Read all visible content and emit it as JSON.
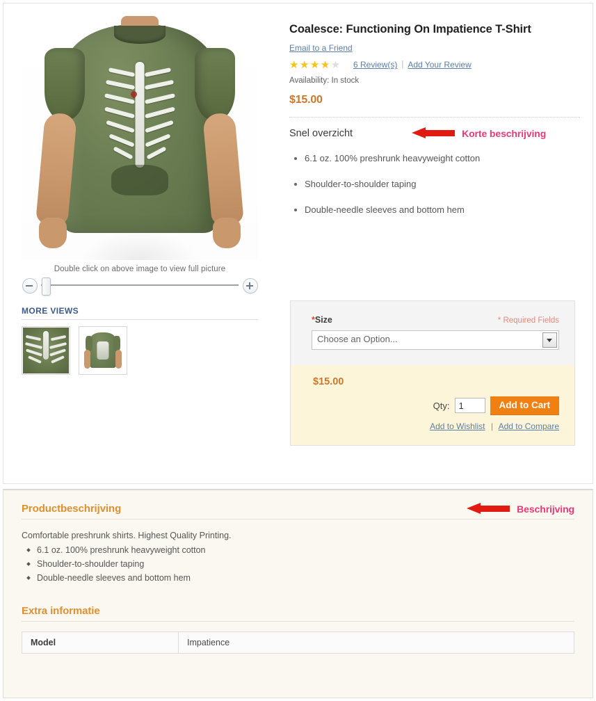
{
  "product": {
    "title": "Coalesce: Functioning On Impatience T-Shirt",
    "email_link": "Email to a Friend",
    "rating_value": 3.5,
    "rating_max": 5,
    "reviews_link": "6 Review(s)",
    "separator": "|",
    "add_review_link": "Add Your Review",
    "availability": "Availability: In stock",
    "price": "$15.00"
  },
  "media": {
    "zoom_hint": "Double click on above image to view full picture",
    "zoom_out_icon": "minus-circle-icon",
    "zoom_in_icon": "plus-circle-icon",
    "more_views_title": "MORE VIEWS",
    "thumbnails": [
      {
        "alt": "ribcage-print-closeup"
      },
      {
        "alt": "model-wearing-shirt"
      }
    ]
  },
  "overview": {
    "heading": "Snel overzicht",
    "items": [
      "6.1 oz. 100% preshrunk heavyweight cotton",
      "Shoulder-to-shoulder taping",
      "Double-needle sleeves and bottom hem"
    ]
  },
  "annotations": {
    "short_description": "Korte beschrijving",
    "description": "Beschrijving",
    "arrow_color": "#e21b12",
    "label_color": "#e73a78"
  },
  "cart": {
    "option_label": "Size",
    "required_marker": "*",
    "required_note": "* Required Fields",
    "select_value": "Choose an Option...",
    "price": "$15.00",
    "qty_label": "Qty:",
    "qty_value": "1",
    "add_to_cart_label": "Add to Cart",
    "wishlist_link": "Add to Wishlist",
    "links_separator": "|",
    "compare_link": "Add to Compare"
  },
  "description_section": {
    "heading": "Productbeschrijving",
    "intro": "Comfortable preshrunk shirts. Highest Quality Printing.",
    "items": [
      "6.1 oz. 100% preshrunk heavyweight cotton",
      "Shoulder-to-shoulder taping",
      "Double-needle sleeves and bottom hem"
    ]
  },
  "extra_info": {
    "heading": "Extra informatie",
    "rows": [
      {
        "label": "Model",
        "value": "Impatience"
      }
    ]
  },
  "colors": {
    "price": "#c8792e",
    "accent_orange": "#f08012",
    "link": "#5b7fa6",
    "star_filled": "#f5c518",
    "section_heading": "#e0902f"
  }
}
